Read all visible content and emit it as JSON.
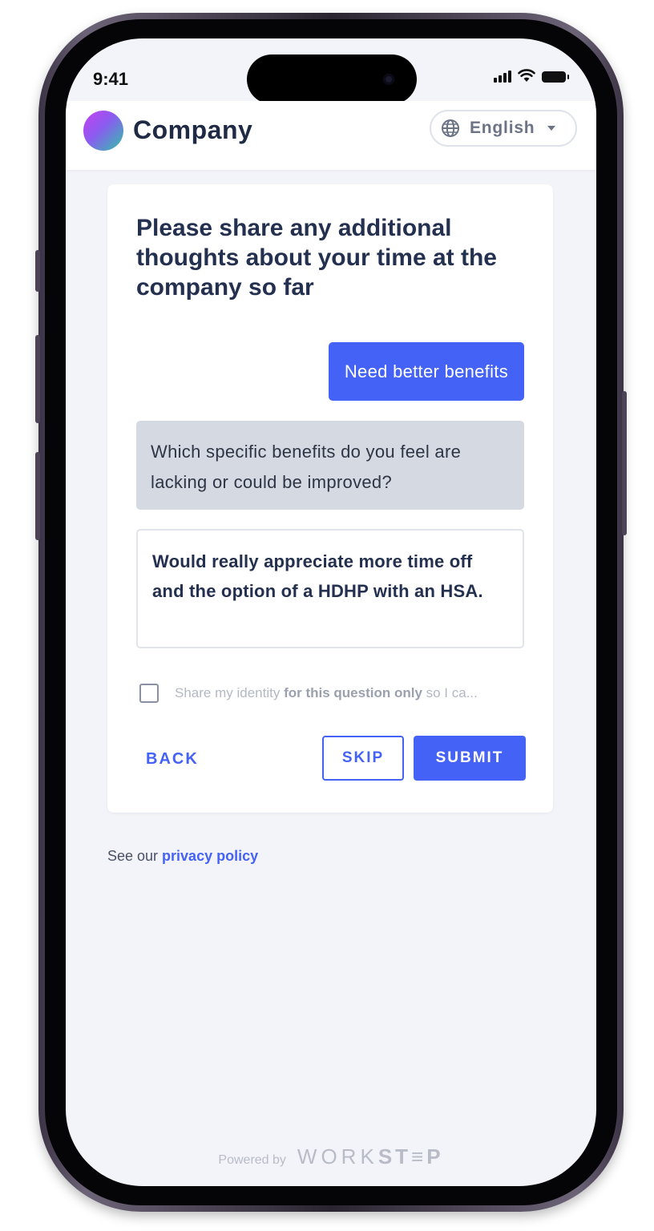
{
  "status_bar": {
    "time": "9:41"
  },
  "header": {
    "company_name": "Company",
    "language_selector": {
      "selected": "English",
      "icon": "globe-icon"
    }
  },
  "question": {
    "title": "Please share any additional thoughts about your time at the company so far",
    "user_reply": "Need better benefits",
    "follow_up_prompt": "Which specific benefits do you feel are lacking or could be improved?",
    "answer_value": "Would really appreciate more time off and the option of a HDHP with an HSA."
  },
  "identity_option": {
    "checked": false,
    "text_part1": "Share my identity ",
    "text_bold": "for this question only",
    "text_part2": " so I ca..."
  },
  "actions": {
    "back_label": "BACK",
    "skip_label": "SKIP",
    "submit_label": "SUBMIT"
  },
  "privacy": {
    "prefix": "See our ",
    "link_label": "privacy policy"
  },
  "footer": {
    "powered_by": "Powered by",
    "brand_light": "WORK",
    "brand_bold": "ST≡P"
  },
  "colors": {
    "accent": "#4462f5",
    "title_text": "#24304f",
    "bot_bubble_bg": "#d5d9e1",
    "page_bg": "#f3f4f9"
  }
}
